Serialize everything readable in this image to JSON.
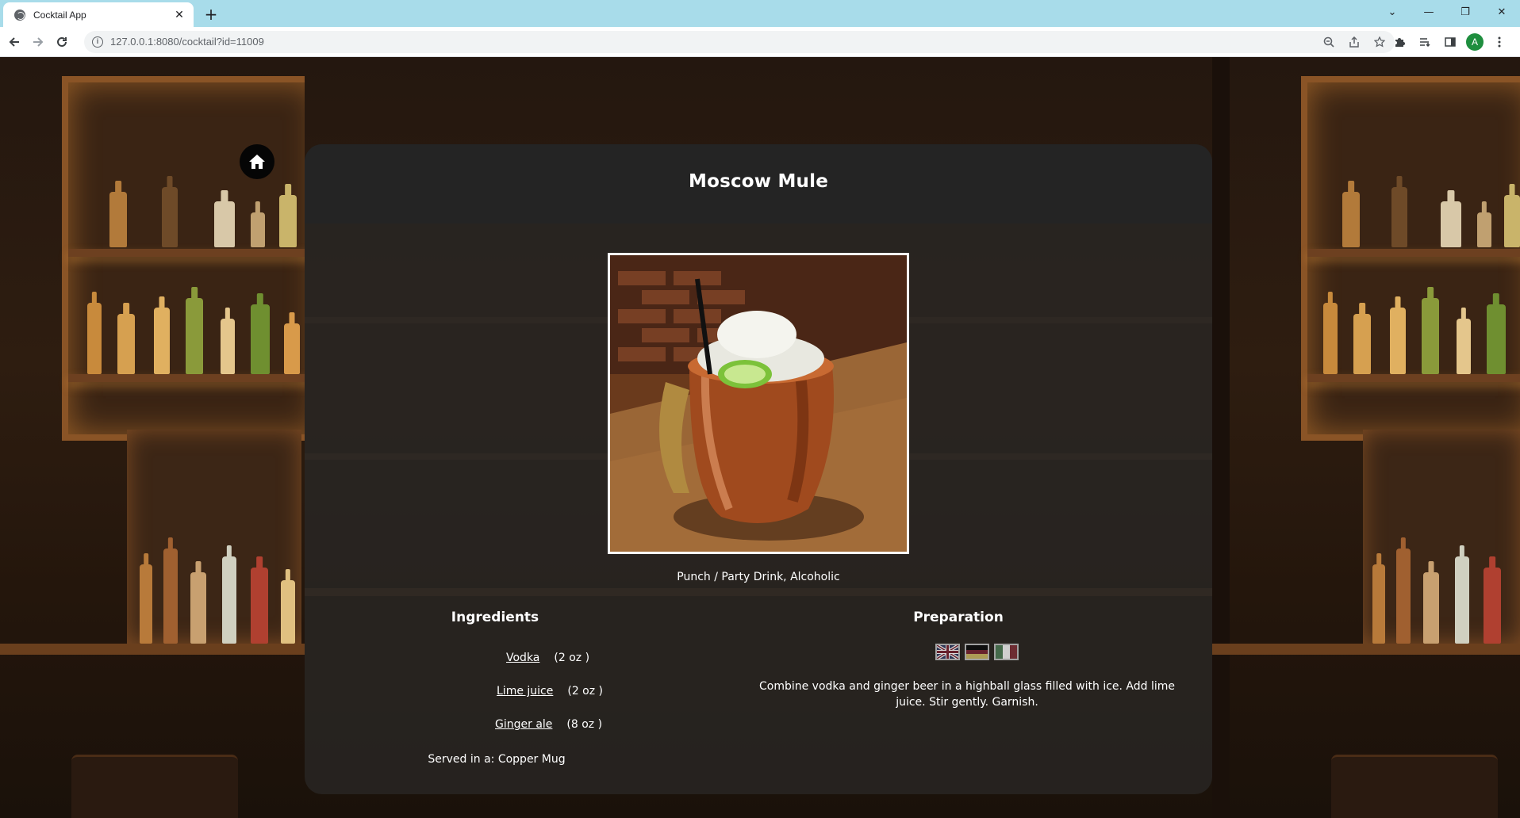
{
  "browser": {
    "tab_title": "Cocktail App",
    "tab_close": "✕",
    "new_tab": "+",
    "url": "127.0.0.1:8080/cocktail?id=11009",
    "avatar_letter": "A",
    "window_controls": [
      "⌄",
      "—",
      "❐",
      "✕"
    ]
  },
  "cocktail": {
    "name": "Moscow Mule",
    "category_line": "Punch / Party Drink, Alcoholic",
    "ingredients_title": "Ingredients",
    "ingredients": [
      {
        "name": "Vodka",
        "measure": "(2 oz )"
      },
      {
        "name": "Lime juice",
        "measure": "(2 oz )"
      },
      {
        "name": "Ginger ale",
        "measure": "(8 oz )"
      }
    ],
    "glass_line": "Served in a: Copper Mug",
    "preparation_title": "Preparation",
    "instructions": "Combine vodka and ginger beer in a highball glass filled with ice. Add lime juice. Stir gently. Garnish.",
    "languages": [
      "english-flag-icon",
      "german-flag-icon",
      "italian-flag-icon"
    ]
  },
  "colors": {
    "tabbar": "#a8dcea",
    "card": "#282624",
    "card_header": "#242424",
    "text": "#ffffff"
  }
}
